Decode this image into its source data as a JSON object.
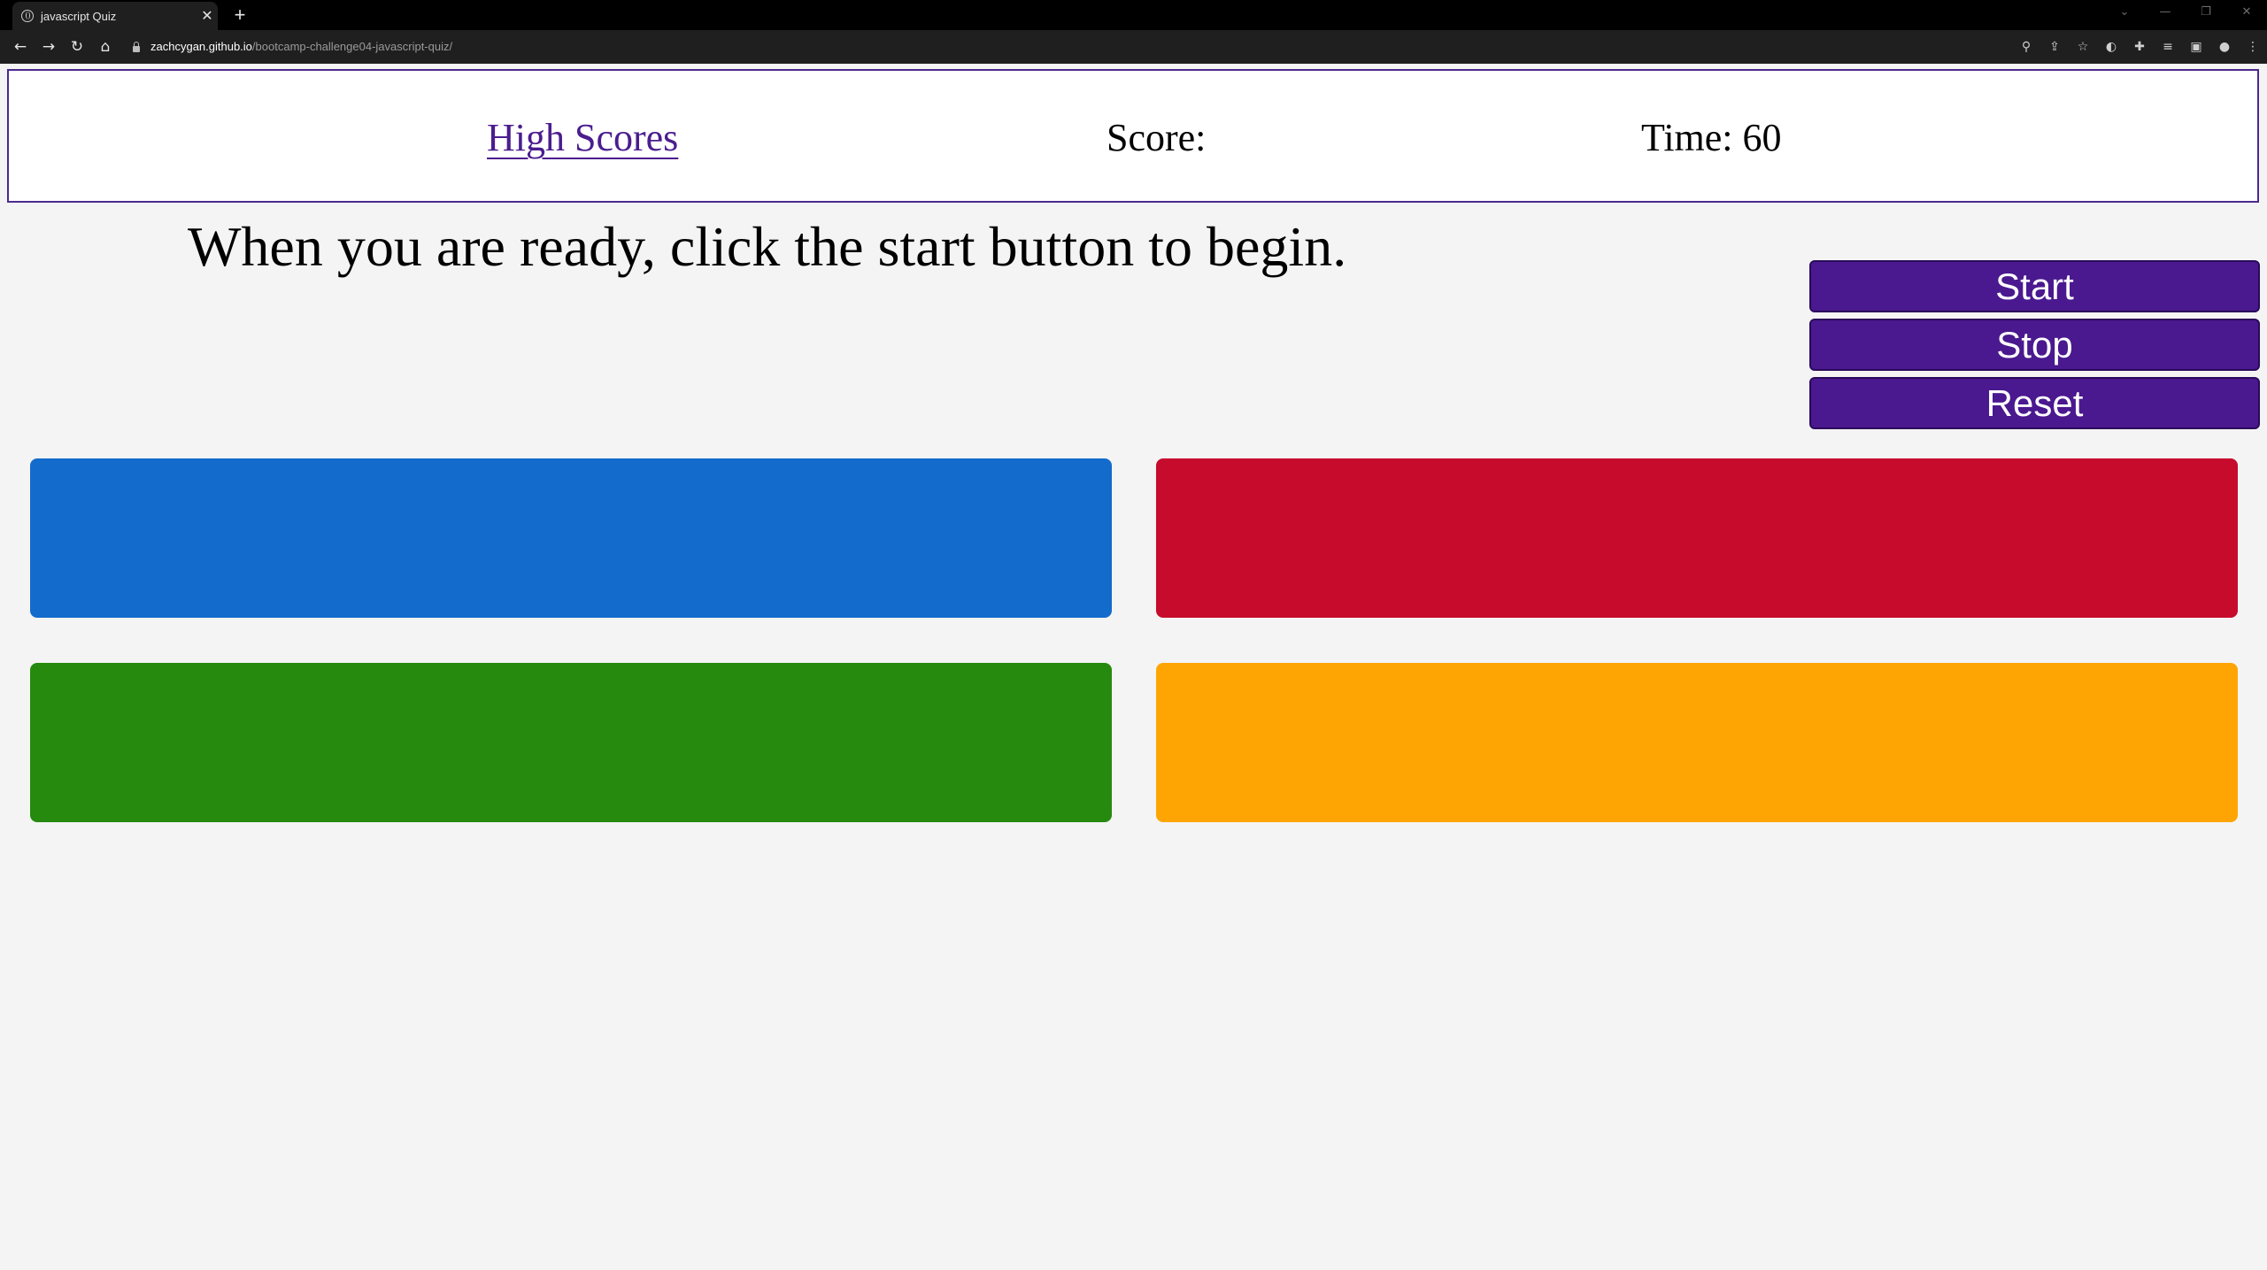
{
  "browser": {
    "tab_title": "javascript Quiz",
    "tab_close": "✕",
    "new_tab": "+",
    "url_host": "zachcygan.github.io",
    "url_path": "/bootcamp-challenge04-javascript-quiz/",
    "icons": [
      "back-arrow-icon",
      "forward-arrow-icon",
      "reload-icon",
      "home-icon",
      "lock-icon",
      "zoom-icon",
      "share-icon",
      "star-icon",
      "extension-icon",
      "puzzle-icon",
      "media-icon",
      "sidepanel-icon",
      "profile-icon",
      "menu-icon"
    ]
  },
  "header": {
    "high_scores_label": "High Scores",
    "score_label": "Score:",
    "time_label": "Time:",
    "time_value": "60"
  },
  "main": {
    "instructions": "When you are ready, click the start button to begin."
  },
  "controls": {
    "start_label": "Start",
    "stop_label": "Stop",
    "reset_label": "Reset"
  },
  "answers": [
    {
      "label": "",
      "color": "#136bcc"
    },
    {
      "label": "",
      "color": "#c60b2c"
    },
    {
      "label": "",
      "color": "#258a0e"
    },
    {
      "label": "",
      "color": "#ffa503"
    }
  ],
  "colors": {
    "accent": "#4a188f",
    "header_border": "#4b2a8e",
    "page_background": "#f4f4f4"
  }
}
